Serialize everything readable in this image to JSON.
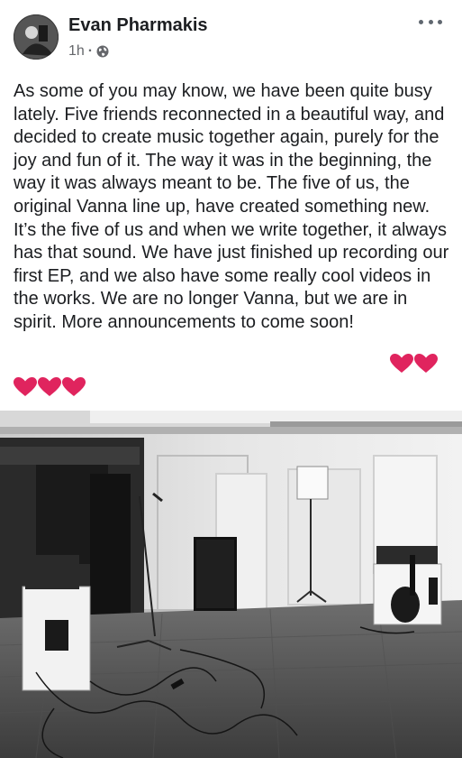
{
  "post": {
    "author": "Evan Pharmakis",
    "time": "1h",
    "separator": "·",
    "audience_icon": "globe-icon",
    "more_icon": "more-options-icon",
    "text": "As some of you may know, we have been quite busy lately. Five friends reconnected in a beautiful way, and decided to create music together again, purely for the joy and fun of it. The way it was in the beginning, the way it was always meant to be. The five of us, the original Vanna line up, have created something new. It’s the five of us and when we write together, it always has that sound. We have just finished up recording our first EP, and we also have some really cool videos in the works. We are no longer Vanna, but we are in spirit. More announcements to come soon!",
    "emoji": [
      "heart",
      "heart",
      "heart",
      "heart",
      "heart"
    ],
    "photo_description_icon": "studio-photo"
  },
  "colors": {
    "text": "#1c1e21",
    "meta": "#65676b",
    "heart": "#e0245e"
  }
}
